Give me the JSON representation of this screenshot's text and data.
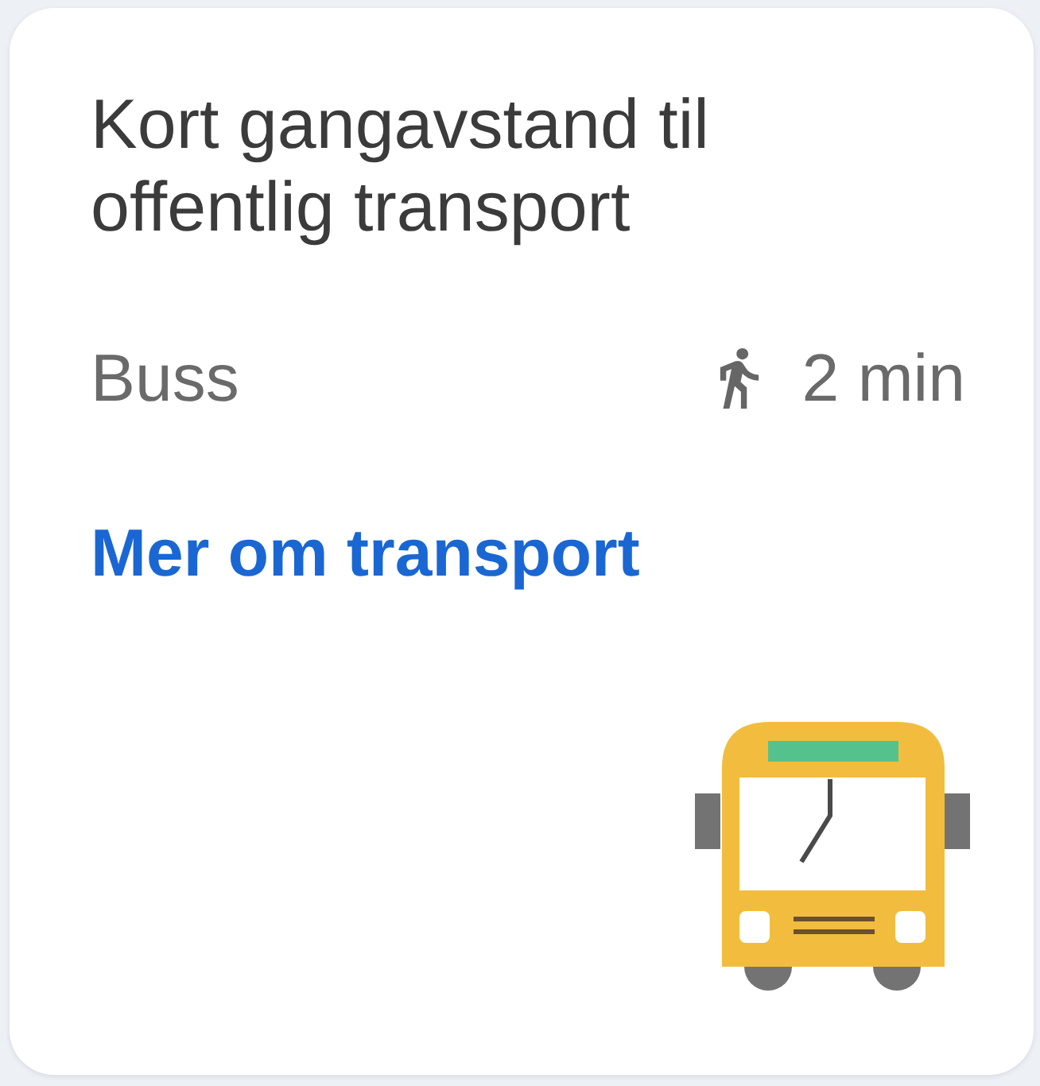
{
  "card": {
    "title": "Kort gangavstand til offentlig transport",
    "transit": {
      "mode": "Buss",
      "walk_time": "2 min"
    },
    "link": "Mer om transport"
  }
}
